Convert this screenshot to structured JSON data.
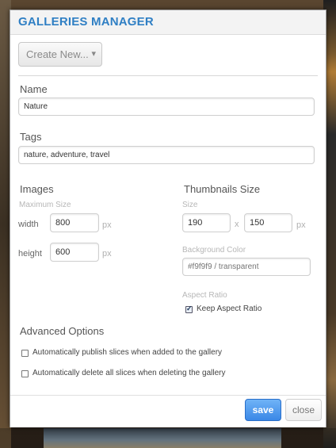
{
  "dialog": {
    "title": "GALLERIES MANAGER",
    "create_button": "Create New...",
    "create_caret": "▾"
  },
  "name": {
    "label": "Name",
    "value": "Nature"
  },
  "tags": {
    "label": "Tags",
    "value": "nature, adventure, travel"
  },
  "images": {
    "heading": "Images",
    "max_size_label": "Maximum Size",
    "width_label": "width",
    "width_value": "800",
    "height_label": "height",
    "height_value": "600",
    "unit": "px"
  },
  "thumbnails": {
    "heading": "Thumbnails Size",
    "size_label": "Size",
    "width_value": "190",
    "separator": "x",
    "height_value": "150",
    "unit": "px",
    "bg_color_label": "Background Color",
    "bg_color_placeholder": "#f9f9f9 / transparent",
    "aspect_ratio_label": "Aspect Ratio",
    "keep_aspect_label": "Keep Aspect Ratio",
    "keep_aspect_checked": true
  },
  "advanced": {
    "heading": "Advanced Options",
    "options": [
      {
        "label": "Automatically publish slices when added to the gallery",
        "checked": false
      },
      {
        "label": "Automatically delete all slices when deleting the gallery",
        "checked": false
      }
    ]
  },
  "footer": {
    "save_label": "save",
    "close_label": "close"
  }
}
